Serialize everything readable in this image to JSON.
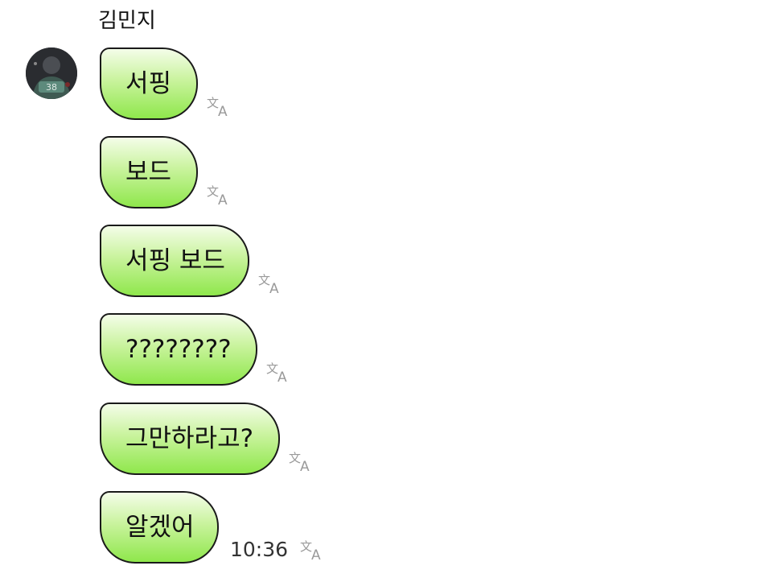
{
  "chat": {
    "sender_name": "김민지",
    "avatar_icon": "user-avatar",
    "messages": [
      {
        "text": "서핑"
      },
      {
        "text": "보드"
      },
      {
        "text": "서핑 보드"
      },
      {
        "text": "????????"
      },
      {
        "text": "그만하라고?"
      },
      {
        "text": "알겠어",
        "time": "10:36"
      }
    ],
    "translate_icon": "translate-icon",
    "colors": {
      "bubble_top": "#f4fde9",
      "bubble_bottom": "#8fe74c",
      "bubble_border": "#1a1a1a",
      "icon_gray": "#9a9a9a"
    }
  }
}
